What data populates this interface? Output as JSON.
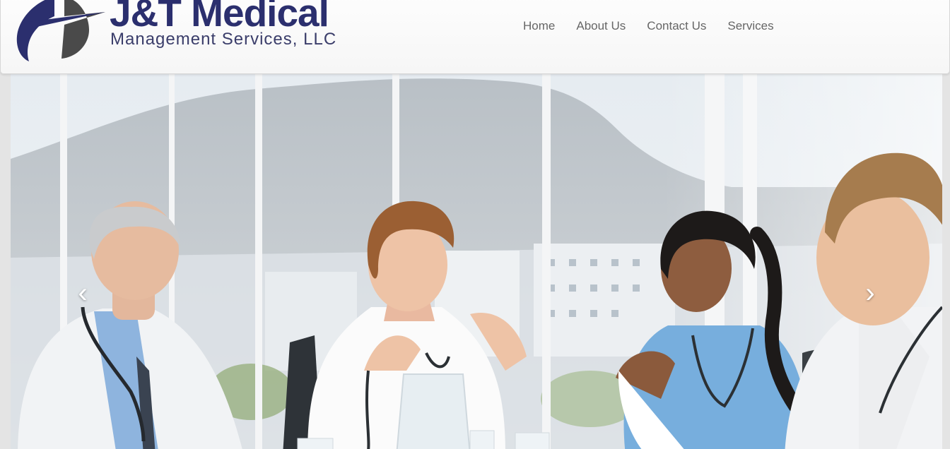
{
  "brand": {
    "name_line1": "J&T Medical",
    "name_line2": "Management Services, LLC"
  },
  "nav": {
    "items": [
      {
        "label": "Home"
      },
      {
        "label": "About Us"
      },
      {
        "label": "Contact Us"
      },
      {
        "label": "Services"
      }
    ]
  },
  "carousel": {
    "prev_icon": "chevron-left-icon",
    "next_icon": "chevron-right-icon",
    "prev_glyph": "‹",
    "next_glyph": "›"
  },
  "colors": {
    "brand_navy": "#2b2f6e",
    "nav_text": "#666666",
    "navbar_bg": "#f8f8f8"
  }
}
